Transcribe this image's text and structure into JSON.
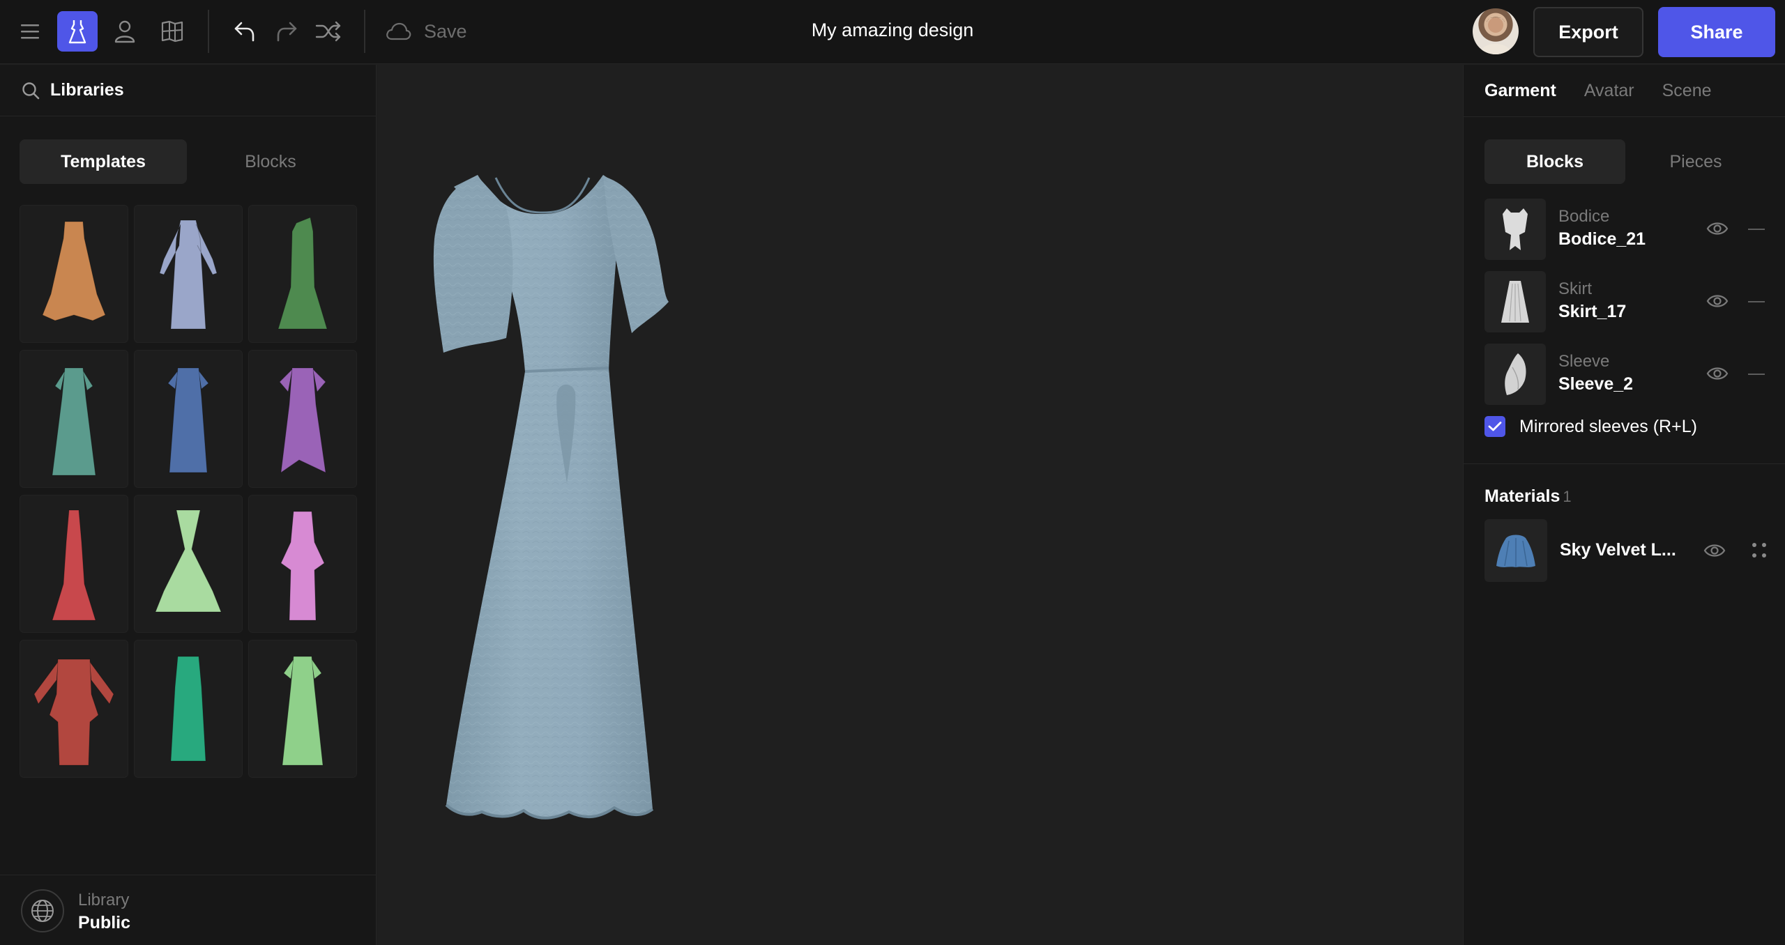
{
  "topbar": {
    "save_label": "Save",
    "doc_title": "My amazing design",
    "export_label": "Export",
    "share_label": "Share"
  },
  "colors": {
    "accent": "#4f56e8",
    "background": "#1e1e1e",
    "panel": "#171717",
    "dress": "#8ca7b7"
  },
  "left_panel": {
    "search_value": "Libraries",
    "tabs": [
      {
        "label": "Templates",
        "active": true
      },
      {
        "label": "Blocks",
        "active": false
      }
    ],
    "templates": [
      {
        "color": "#c98650",
        "icon": "dress-orange-ruffle-icon"
      },
      {
        "color": "#9aa6c9",
        "icon": "dress-lavender-longsleeve-icon"
      },
      {
        "color": "#4e8a4f",
        "icon": "dress-green-mermaid-icon"
      },
      {
        "color": "#5b9b8d",
        "icon": "dress-teal-tiered-icon"
      },
      {
        "color": "#4f6fa8",
        "icon": "dress-blue-sheath-icon"
      },
      {
        "color": "#9a63b7",
        "icon": "dress-purple-ruffle-icon"
      },
      {
        "color": "#c8484c",
        "icon": "dress-red-mermaid-icon"
      },
      {
        "color": "#a9dba0",
        "icon": "dress-mint-vneck-icon"
      },
      {
        "color": "#d78ad3",
        "icon": "dress-pink-peplum-icon"
      },
      {
        "color": "#b2473f",
        "icon": "dress-red-puffsleeve-icon"
      },
      {
        "color": "#28a97e",
        "icon": "dress-green-pattern-icon"
      },
      {
        "color": "#8fd08a",
        "icon": "dress-lightgreen-wrap-icon"
      }
    ],
    "library_caption": "Library",
    "library_value": "Public"
  },
  "right_panel": {
    "tabs": [
      {
        "label": "Garment",
        "active": true
      },
      {
        "label": "Avatar",
        "active": false
      },
      {
        "label": "Scene",
        "active": false
      }
    ],
    "seg_tabs": [
      {
        "label": "Blocks",
        "active": true
      },
      {
        "label": "Pieces",
        "active": false
      }
    ],
    "blocks": [
      {
        "caption": "Bodice",
        "value": "Bodice_21"
      },
      {
        "caption": "Skirt",
        "value": "Skirt_17"
      },
      {
        "caption": "Sleeve",
        "value": "Sleeve_2"
      }
    ],
    "mirrored_label": "Mirrored sleeves (R+L)",
    "mirrored_checked": true,
    "materials_title": "Materials",
    "materials_count": "1",
    "materials": [
      {
        "name": "Sky Velvet L..."
      }
    ]
  }
}
